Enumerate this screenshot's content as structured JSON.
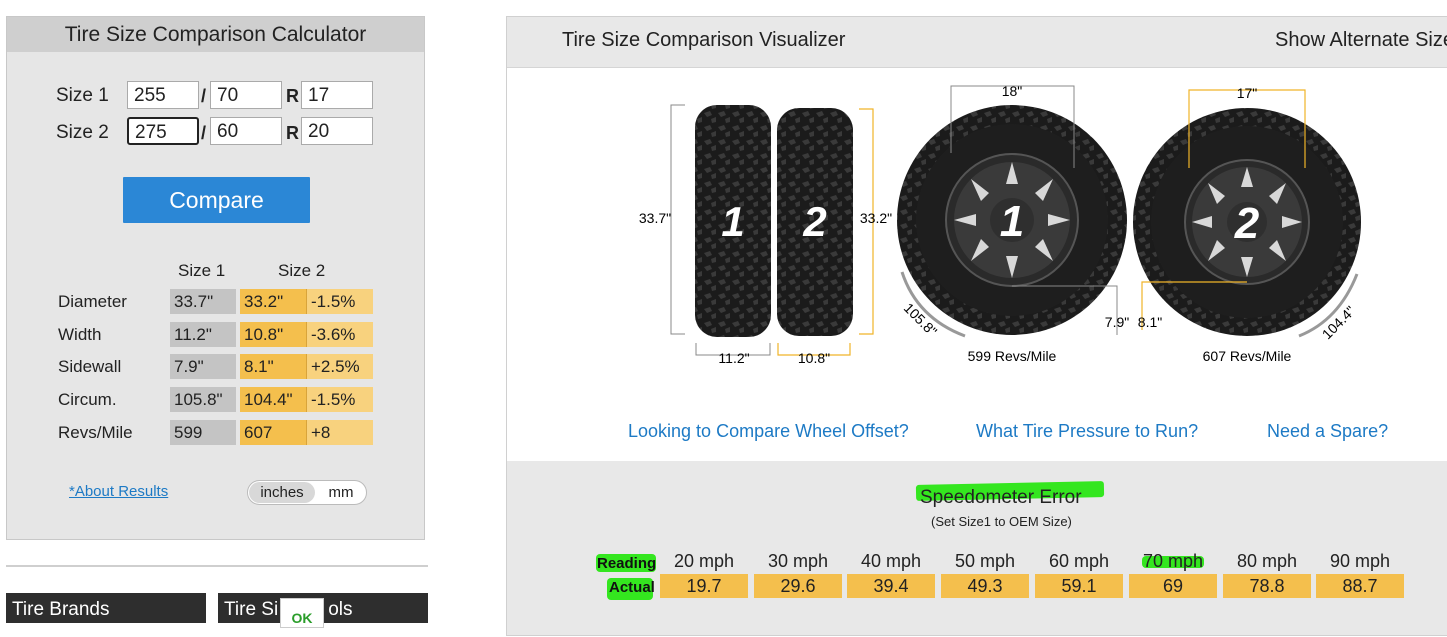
{
  "calculator": {
    "title": "Tire Size Comparison Calculator",
    "size1": {
      "label": "Size 1",
      "width": "255",
      "ratio": "70",
      "rim": "17"
    },
    "size2": {
      "label": "Size 2",
      "width": "275",
      "ratio": "60",
      "rim": "20"
    },
    "slash": "/",
    "r_label": "R",
    "compare_label": "Compare",
    "col_size1": "Size 1",
    "col_size2": "Size 2",
    "rows": [
      {
        "label": "Diameter",
        "s1": "33.7\"",
        "s2": "33.2\"",
        "diff": "-1.5%"
      },
      {
        "label": "Width",
        "s1": "11.2\"",
        "s2": "10.8\"",
        "diff": "-3.6%"
      },
      {
        "label": "Sidewall",
        "s1": "7.9\"",
        "s2": "8.1\"",
        "diff": "+2.5%"
      },
      {
        "label": "Circum.",
        "s1": "105.8\"",
        "s2": "104.4\"",
        "diff": "-1.5%"
      },
      {
        "label": "Revs/Mile",
        "s1": "599",
        "s2": "607",
        "diff": "+8"
      }
    ],
    "about_link": "*About Results",
    "unit_inches": "inches",
    "unit_mm": "mm"
  },
  "bottom_tabs": {
    "tire_brands": "Tire Brands",
    "tire_tools_a": "Tire Si",
    "tire_tools_b": "ols",
    "ok": "OK"
  },
  "visualizer": {
    "title": "Tire Size Comparison Visualizer",
    "alt_size": "Show Alternate Size",
    "tire1_num": "1",
    "tire2_num": "2",
    "height1": "33.7\"",
    "height2": "33.2\"",
    "width1": "11.2\"",
    "width2": "10.8\"",
    "rim1": "18\"",
    "rim2": "17\"",
    "sidewall1": "7.9\"",
    "sidewall2": "8.1\"",
    "circ1": "105.8\"",
    "circ2": "104.4\"",
    "revs1": "599 Revs/Mile",
    "revs2": "607 Revs/Mile",
    "links": [
      "Looking to Compare Wheel Offset?",
      "What Tire Pressure to Run?",
      "Need a Spare?"
    ]
  },
  "speedometer": {
    "title": "Speedometer Error",
    "subtitle": "(Set Size1 to OEM Size)",
    "reading_label": "Reading",
    "actual_label": "Actual",
    "readings": [
      "20 mph",
      "30 mph",
      "40 mph",
      "50 mph",
      "60 mph",
      "70 mph",
      "80 mph",
      "90 mph"
    ],
    "actual": [
      "19.7",
      "29.6",
      "39.4",
      "49.3",
      "59.1",
      "69",
      "78.8",
      "88.7"
    ]
  },
  "colors": {
    "accent_blue": "#2b87d6",
    "size2_orange": "#f4bf4d",
    "highlight_green": "#34e61f",
    "link_blue": "#1d7ac5"
  }
}
